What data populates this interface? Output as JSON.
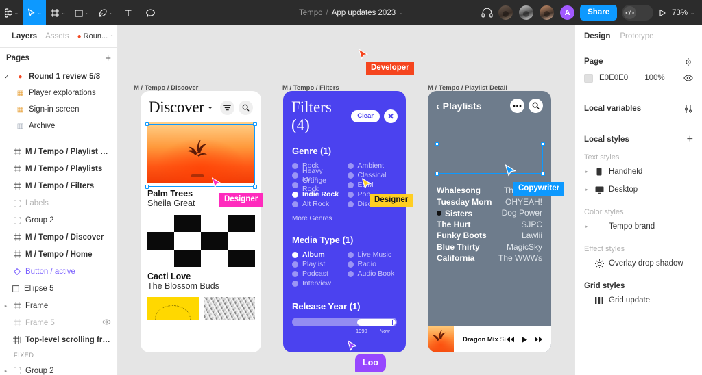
{
  "toolbar": {
    "tools": [
      {
        "name": "main-menu",
        "icon": "figma-logo-icon",
        "has_caret": true,
        "active": false
      },
      {
        "name": "move-tool",
        "icon": "cursor-icon",
        "has_caret": true,
        "active": true
      },
      {
        "name": "frame-tool",
        "icon": "frame-icon",
        "has_caret": true,
        "active": false
      },
      {
        "name": "shape-tool",
        "icon": "square-icon",
        "has_caret": true,
        "active": false
      },
      {
        "name": "pen-tool",
        "icon": "pen-icon",
        "has_caret": true,
        "active": false
      },
      {
        "name": "text-tool",
        "icon": "text-icon",
        "has_caret": false,
        "active": false
      },
      {
        "name": "comment-tool",
        "icon": "comment-icon",
        "has_caret": false,
        "active": false
      }
    ],
    "project": "Tempo",
    "separator": "/",
    "file_name": "App updates 2023",
    "title_caret": "⌄",
    "audio_icon": "headphones-icon",
    "collaborators": [
      {
        "name": "avatar-1",
        "initial": ""
      },
      {
        "name": "avatar-2",
        "initial": ""
      },
      {
        "name": "avatar-3",
        "initial": ""
      },
      {
        "name": "avatar-4",
        "initial": "A"
      }
    ],
    "share_label": "Share",
    "dev_mode_icon": "code-icon",
    "present_icon": "play-icon",
    "zoom_value": "73%",
    "zoom_caret": "⌄"
  },
  "left_panel": {
    "tabs": [
      {
        "label": "Layers",
        "active": true
      },
      {
        "label": "Assets",
        "active": false
      }
    ],
    "page_chip": {
      "pin": "📍",
      "label": "Roun...",
      "caret": "⌃"
    },
    "pages_header": {
      "label": "Pages",
      "add": "+"
    },
    "pages": [
      {
        "label": "Round 1 review 5/8",
        "icon": "pin-icon",
        "selected": true,
        "bold": true
      },
      {
        "label": "Player explorations",
        "icon": "grid-icon",
        "selected": false,
        "bold": false
      },
      {
        "label": "Sign-in screen",
        "icon": "grid-icon",
        "selected": false,
        "bold": false
      },
      {
        "label": "Archive",
        "icon": "archive-icon",
        "selected": false,
        "bold": false
      }
    ],
    "layers": [
      {
        "label": "M / Tempo / Playlist Detail",
        "icon": "frame-icon",
        "bold": true,
        "style": "normal",
        "indent": 0,
        "arrow": "",
        "eye": false
      },
      {
        "label": "M / Tempo / Playlists",
        "icon": "frame-icon",
        "bold": true,
        "style": "normal",
        "indent": 0,
        "arrow": "",
        "eye": false
      },
      {
        "label": "M / Tempo / Filters",
        "icon": "frame-icon",
        "bold": true,
        "style": "normal",
        "indent": 0,
        "arrow": "",
        "eye": false
      },
      {
        "label": "Labels",
        "icon": "group-icon",
        "bold": false,
        "style": "muted",
        "indent": 0,
        "arrow": "",
        "eye": false
      },
      {
        "label": "Group 2",
        "icon": "group-icon",
        "bold": false,
        "style": "normal",
        "indent": 0,
        "arrow": "",
        "eye": false
      },
      {
        "label": "M / Tempo / Discover",
        "icon": "frame-icon",
        "bold": true,
        "style": "normal",
        "indent": 0,
        "arrow": "",
        "eye": false
      },
      {
        "label": "M / Tempo / Home",
        "icon": "frame-icon",
        "bold": true,
        "style": "normal",
        "indent": 0,
        "arrow": "",
        "eye": false
      },
      {
        "label": "Button / active",
        "icon": "component-icon",
        "bold": false,
        "style": "component",
        "indent": 0,
        "arrow": "",
        "eye": false
      },
      {
        "label": "Ellipse 5",
        "icon": "square-icon",
        "bold": false,
        "style": "normal",
        "indent": 1,
        "arrow": "",
        "eye": false
      },
      {
        "label": "Frame",
        "icon": "frame-icon",
        "bold": false,
        "style": "normal",
        "indent": 1,
        "arrow": "▸",
        "eye": false
      },
      {
        "label": "Frame 5",
        "icon": "frame-icon",
        "bold": false,
        "style": "muted",
        "indent": 0,
        "arrow": "",
        "eye": true
      },
      {
        "label": "Top-level scrolling frame",
        "icon": "scroll-frame-icon",
        "bold": true,
        "style": "normal",
        "indent": 0,
        "arrow": "",
        "eye": false
      },
      {
        "label": "FIXED",
        "icon": "",
        "bold": false,
        "style": "tiny",
        "indent": 1,
        "arrow": "",
        "eye": false
      },
      {
        "label": "Group 2",
        "icon": "group-icon",
        "bold": false,
        "style": "normal",
        "indent": 1,
        "arrow": "▸",
        "eye": false
      }
    ]
  },
  "right_panel": {
    "tabs": [
      {
        "label": "Design",
        "active": true
      },
      {
        "label": "Prototype",
        "active": false
      }
    ],
    "page": {
      "title": "Page",
      "settings_icon": "page-settings-icon",
      "color_hex": "E0E0E0",
      "opacity": "100%",
      "visibility_icon": "eye-icon"
    },
    "local_variables": {
      "title": "Local variables",
      "icon": "variables-icon"
    },
    "local_styles": {
      "title": "Local styles",
      "add": "+",
      "groups": [
        {
          "label": "Text styles",
          "items": [
            {
              "label": "Handheld",
              "icon": "handheld-icon",
              "arrow": "▸"
            },
            {
              "label": "Desktop",
              "icon": "desktop-icon",
              "arrow": "▸"
            }
          ]
        },
        {
          "label": "Color styles",
          "items": [
            {
              "label": "Tempo brand",
              "icon": "",
              "arrow": "▸"
            }
          ]
        },
        {
          "label": "Effect styles",
          "items": [
            {
              "label": "Overlay drop shadow",
              "icon": "effect-icon",
              "arrow": ""
            }
          ]
        },
        {
          "label": "Grid styles",
          "bold": true,
          "items": [
            {
              "label": "Grid update",
              "icon": "grid-style-icon",
              "arrow": ""
            }
          ]
        }
      ]
    }
  },
  "canvas": {
    "background_hex": "E5E5E5",
    "frames": [
      {
        "name": "discover",
        "label": "M / Tempo / Discover"
      },
      {
        "name": "filters",
        "label": "M / Tempo / Filters"
      },
      {
        "name": "playlist-detail",
        "label": "M / Tempo / Playlist Detail"
      }
    ],
    "discover": {
      "title": "Discover",
      "title_caret": "⌄",
      "filter_icon": "filter-icon",
      "search_icon": "search-icon",
      "cards": [
        {
          "title": "Palm Trees",
          "artist": "Sheila Great",
          "art": "sunset-photo"
        },
        {
          "title": "Cacti Love",
          "artist": "The Blossom Buds",
          "art": "checkerboard"
        }
      ]
    },
    "filters": {
      "title": "Filters (4)",
      "clear_label": "Clear",
      "close_label": "✕",
      "sections": [
        {
          "title": "Genre (1)",
          "options_left": [
            {
              "label": "Rock",
              "selected": false
            },
            {
              "label": "Heavy Metal",
              "selected": false
            },
            {
              "label": "Grunge Rock",
              "selected": false
            },
            {
              "label": "Indie Rock",
              "selected": true
            },
            {
              "label": "Alt Rock",
              "selected": false
            }
          ],
          "options_right": [
            {
              "label": "Ambient",
              "selected": false
            },
            {
              "label": "Classical",
              "selected": false
            },
            {
              "label": "EDM",
              "selected": false
            },
            {
              "label": "Pop",
              "selected": false
            },
            {
              "label": "Disco",
              "selected": false
            }
          ],
          "more_label": "More Genres"
        },
        {
          "title": "Media Type (1)",
          "options_left": [
            {
              "label": "Album",
              "selected": true
            },
            {
              "label": "Playlist",
              "selected": false
            },
            {
              "label": "Podcast",
              "selected": false
            },
            {
              "label": "Interview",
              "selected": false
            }
          ],
          "options_right": [
            {
              "label": "Live Music",
              "selected": false
            },
            {
              "label": "Radio",
              "selected": false
            },
            {
              "label": "Audio Book",
              "selected": false
            }
          ],
          "more_label": ""
        }
      ],
      "release_year": {
        "title": "Release Year (1)",
        "min_label": "1990",
        "max_label": "Now"
      }
    },
    "playlist_detail": {
      "back_caret": "‹",
      "back_label": "Playlists",
      "more_icon": "more-icon",
      "search_icon": "search-icon",
      "tracks": [
        {
          "name": "Whalesong",
          "artist": "The Drags",
          "playing": false
        },
        {
          "name": "Tuesday Morn",
          "artist": "OHYEAH!",
          "playing": false
        },
        {
          "name": "Sisters",
          "artist": "Dog Power",
          "playing": true
        },
        {
          "name": "The Hurt",
          "artist": "SJPC",
          "playing": false
        },
        {
          "name": "Funky Boots",
          "artist": "Lawlii",
          "playing": false
        },
        {
          "name": "Blue Thirty",
          "artist": "MagicSky",
          "playing": false
        },
        {
          "name": "California",
          "artist": "The WWWs",
          "playing": false
        }
      ],
      "player": {
        "title": "Dragon Mix",
        "subtitle": "Sist",
        "prev_icon": "prev-icon",
        "play_icon": "play-icon",
        "next_icon": "next-icon"
      }
    },
    "cursors": [
      {
        "name": "developer",
        "label": "Developer",
        "color": "#F5451E",
        "text_color": "#FFFFFF",
        "rounded": false
      },
      {
        "name": "designer-pink",
        "label": "Designer",
        "color": "#FF2BBD",
        "text_color": "#FFFFFF",
        "rounded": false
      },
      {
        "name": "designer-yellow",
        "label": "Designer",
        "color": "#FFCE22",
        "text_color": "#1A1A1A",
        "rounded": false
      },
      {
        "name": "copywriter",
        "label": "Copywriter",
        "color": "#0D99FF",
        "text_color": "#FFFFFF",
        "rounded": false
      },
      {
        "name": "loo",
        "label": "Loo",
        "color": "#9747FF",
        "text_color": "#FFFFFF",
        "rounded": true
      }
    ]
  }
}
